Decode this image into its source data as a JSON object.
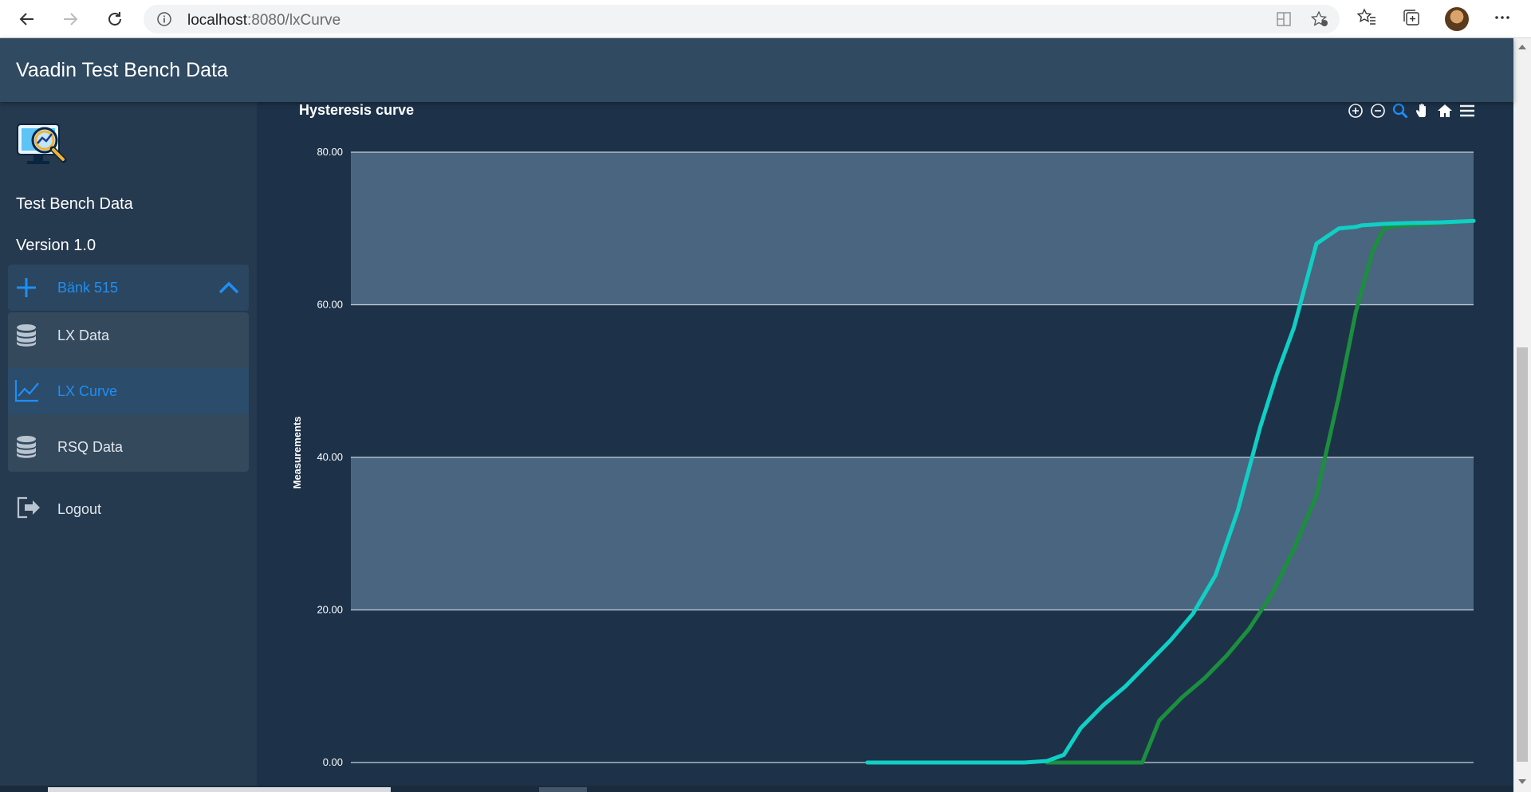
{
  "browser": {
    "url_host": "localhost",
    "url_path": ":8080/lxCurve"
  },
  "header": {
    "title": "Vaadin Test Bench Data"
  },
  "sidebar": {
    "app_name": "Test Bench Data",
    "version": "Version 1.0",
    "group": {
      "label": "Bänk 515",
      "icon": "plus-icon",
      "expanded": true
    },
    "items": [
      {
        "label": "LX Data",
        "icon": "database-icon",
        "active": false
      },
      {
        "label": "LX Curve",
        "icon": "line-chart-icon",
        "active": true
      },
      {
        "label": "RSQ Data",
        "icon": "database-icon",
        "active": false
      }
    ],
    "logout": {
      "label": "Logout",
      "icon": "logout-icon"
    }
  },
  "chart_toolbar": [
    "zoom-in-icon",
    "zoom-out-icon",
    "selection-zoom-icon",
    "pan-icon",
    "reset-home-icon",
    "menu-icon"
  ],
  "chart_data": {
    "type": "line",
    "title": "Hysteresis curve",
    "xlabel": "",
    "ylabel": "Measurements",
    "ylim": [
      0,
      80
    ],
    "yticks": [
      "0.00",
      "20.00",
      "40.00",
      "60.00",
      "80.00"
    ],
    "xlim": [
      0,
      100
    ],
    "grid": true,
    "legend": "none",
    "colors": {
      "band": "#4a6580",
      "grid": "#c8d2dc",
      "series1": "#10cfc4",
      "series2": "#1b8f3e"
    },
    "series": [
      {
        "color": "#10cfc4",
        "x": [
          46,
          55,
          60,
          62,
          63.5,
          65,
          67,
          69,
          71,
          73,
          75,
          77,
          79,
          81,
          82.5,
          84,
          86,
          88,
          89.5,
          90,
          91,
          92,
          94,
          97,
          100
        ],
        "y": [
          0,
          0,
          0,
          0.2,
          1,
          4.5,
          7.5,
          10,
          13,
          16,
          19.5,
          24.5,
          33,
          44,
          51,
          57,
          68,
          70,
          70.2,
          70.4,
          70.5,
          70.6,
          70.7,
          70.8,
          71
        ]
      },
      {
        "color": "#1b8f3e",
        "x": [
          62,
          70,
          70.5,
          72,
          74,
          76,
          78,
          80,
          82,
          84,
          86,
          88,
          89.5,
          91,
          92,
          93,
          95,
          97,
          100
        ],
        "y": [
          0,
          0,
          0,
          5.5,
          8.5,
          11,
          14,
          17.5,
          22,
          28,
          35,
          48,
          59,
          67,
          70,
          70.3,
          70.5,
          70.7,
          71
        ]
      }
    ]
  }
}
